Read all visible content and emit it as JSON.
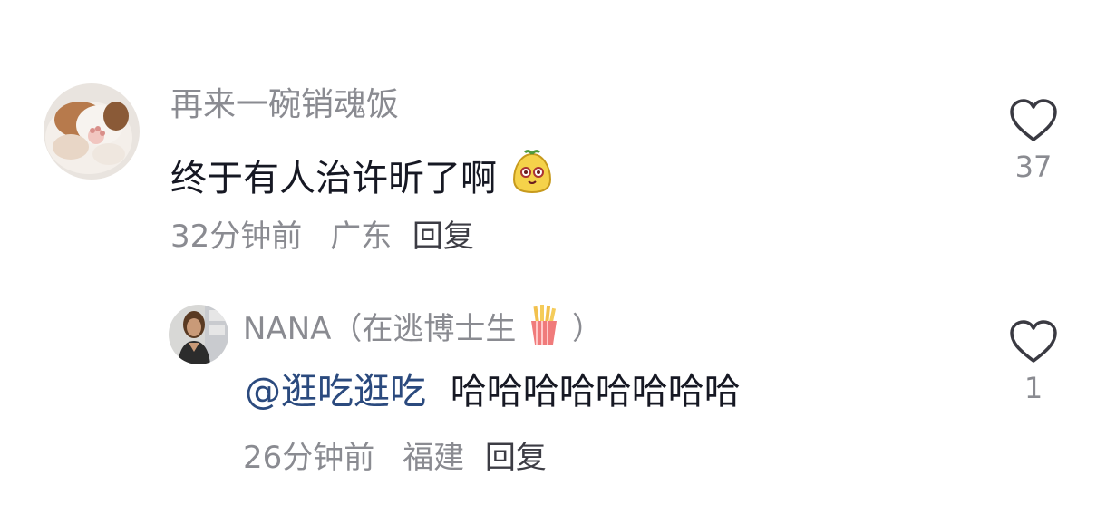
{
  "comments": [
    {
      "username": "再来一碗销魂饭",
      "text": "终于有人治许昕了啊",
      "emoji": "dumpling-face-emoji",
      "time": "32分钟前",
      "location": "广东",
      "reply_label": "回复",
      "like_count": "37",
      "avatar": "puppy-avatar"
    }
  ],
  "replies": [
    {
      "username_prefix": "NANA（",
      "username_text": "在逃博士生",
      "username_emoji": "french-fries-emoji",
      "username_suffix": "）",
      "mention": "@逛吃逛吃",
      "text": "哈哈哈哈哈哈哈哈",
      "time": "26分钟前",
      "location": "福建",
      "reply_label": "回复",
      "like_count": "1",
      "avatar": "woman-avatar"
    }
  ],
  "colors": {
    "username": "#8a8b91",
    "text": "#161823",
    "mention": "#2b4a7e",
    "heart_outline": "#3a3a42"
  }
}
